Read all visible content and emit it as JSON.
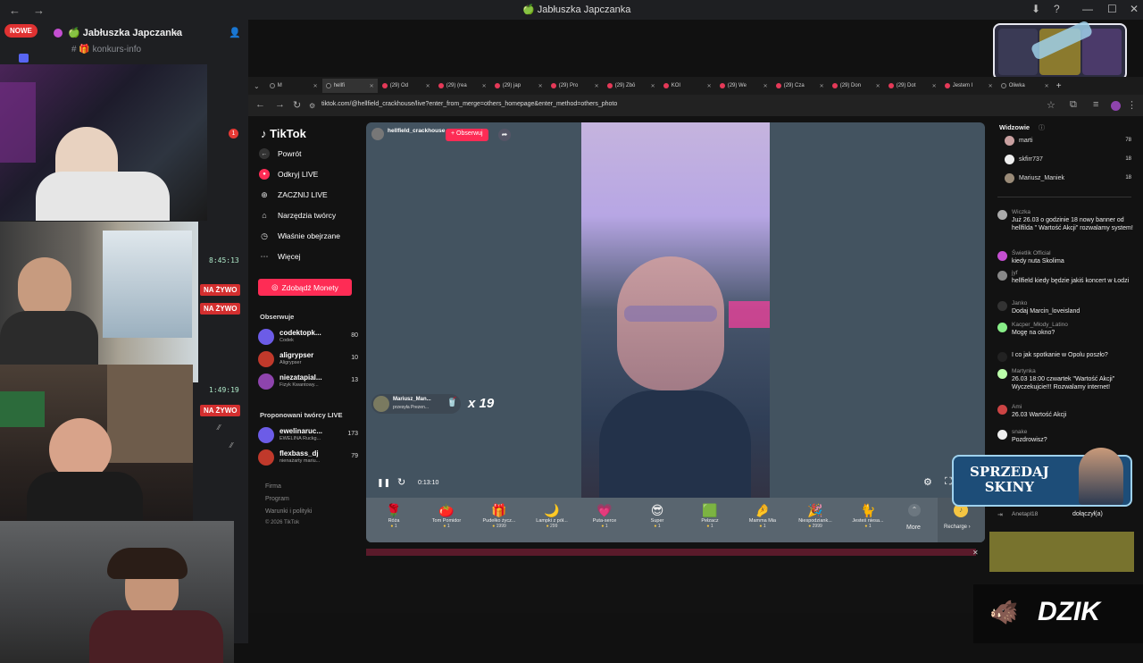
{
  "window": {
    "title": "🍏 Jabłuszka Japczanka",
    "back": "←",
    "forward": "→",
    "controls": [
      "—",
      "☐",
      "✕"
    ]
  },
  "discord": {
    "badge_new": "NOWE",
    "server_name": "🍏 Jabłuszka Japczanka",
    "channel": "# 🎁 konkurs-info",
    "notification_count": "1",
    "streams": [
      {
        "time": "8:45:13",
        "live": "NA ŻYWO"
      },
      {
        "time": "",
        "live": "NA ŻYWO"
      },
      {
        "time": "1:49:19",
        "live": "NA ŻYWO"
      }
    ]
  },
  "browser": {
    "tabs": [
      "M",
      "hellfi",
      "(29) Od",
      "(29) (rea",
      "(29) jap",
      "(29) Pro",
      "(29) Zbō",
      "KOI",
      "(29) We",
      "(29) Cza",
      "(29) Don",
      "(29) Dot",
      "Jestem I",
      "Oliwka"
    ],
    "url": "tiktok.com/@hellfield_crackhouse/live?enter_from_merge=others_homepage&enter_method=others_photo"
  },
  "tiktok": {
    "logo": "TikTok",
    "back_label": "Powrót",
    "menu": [
      {
        "icon": "live-icon",
        "label": "Odkryj LIVE"
      },
      {
        "icon": "go-live-icon",
        "label": "ZACZNIJ LIVE"
      },
      {
        "icon": "tools-icon",
        "label": "Narzędzia twórcy"
      },
      {
        "icon": "history-icon",
        "label": "Właśnie obejrzane"
      },
      {
        "icon": "more-icon",
        "label": "Więcej"
      }
    ],
    "coins_button": "Zdobądź Monety",
    "following_title": "Obserwuje",
    "following": [
      {
        "name": "codektopk...",
        "sub": "Codek",
        "count": "80"
      },
      {
        "name": "aligrypser",
        "sub": "Aligrypser",
        "count": "10"
      },
      {
        "name": "niezatapial...",
        "sub": "Fizyk Kwantowy...",
        "count": "13"
      }
    ],
    "suggested_title": "Proponowani twórcy LIVE",
    "suggested": [
      {
        "name": "ewelinaruc...",
        "sub": "EWELINA Ruckg...",
        "count": "173"
      },
      {
        "name": "flexbass_dj",
        "sub": "nienażarty mariu...",
        "count": "79"
      }
    ],
    "footer": [
      "Firma",
      "Program",
      "Warunki i polityki",
      "© 2026 TikTok"
    ],
    "host": {
      "name": "hellfield_crackhouse",
      "follow": "+ Obserwuj"
    },
    "gift_notice": {
      "user": "Mariusz_Man...",
      "action": "przesyła Prezen...",
      "multiplier": "x 19"
    },
    "player": {
      "time": "0:13:10"
    },
    "gifts": [
      {
        "name": "Róża",
        "price": "1",
        "icon": "🌹"
      },
      {
        "name": "Tom Pomidor",
        "price": "1",
        "icon": "🍅"
      },
      {
        "name": "Pudełko życz...",
        "price": "1999",
        "icon": "🎁"
      },
      {
        "name": "Lampki z pół...",
        "price": "299",
        "icon": "🌙"
      },
      {
        "name": "Puta-serce",
        "price": "1",
        "icon": "💗"
      },
      {
        "name": "Super",
        "price": "1",
        "icon": "😎"
      },
      {
        "name": "Pełzacz",
        "price": "1",
        "icon": "🟩"
      },
      {
        "name": "Mamma Mia",
        "price": "1",
        "icon": "🤌"
      },
      {
        "name": "Niespodziank...",
        "price": "2999",
        "icon": "🎉"
      },
      {
        "name": "Jesteś niesa...",
        "price": "1",
        "icon": "🐈"
      }
    ],
    "more_label": "More",
    "recharge_label": "Recharge ›",
    "viewers_title": "Widzowie",
    "viewers": [
      {
        "name": "marti",
        "count": "78"
      },
      {
        "name": "skfirr737",
        "count": "18"
      },
      {
        "name": "Mariusz_Maniek",
        "count": "18"
      }
    ],
    "chat": [
      {
        "user": "Wiczka",
        "text": "Już 26.03 o godzinie 18 nowy banner od hellfilda \" Wartość Akcji\" rozwalamy system!"
      },
      {
        "user": "Świetlik Official",
        "text": "kiedy nuta Skolima"
      },
      {
        "user": "jyf",
        "text": "hellfield kiedy będzie jakiś koncert w Łodzi"
      },
      {
        "user": "Janko",
        "text": "Dodaj Marcin_loveisland"
      },
      {
        "user": "Kacper_Młody_Latino",
        "text": "Mogę na okno?"
      },
      {
        "user": "",
        "text": "I co jak spotkanie w Opolu poszło?"
      },
      {
        "user": "Martynka",
        "text": "26.03 18:00 czwartek \"Wartość Akcji\" Wyczekujcie!!! Rozwalamy internet!"
      },
      {
        "user": "Ami",
        "text": "26.03 Wartość Akcji"
      },
      {
        "user": "snake",
        "text": "Pozdrowisz?"
      }
    ],
    "join_notice": {
      "user": "Anetapl18",
      "action": "dołączył(a)"
    }
  },
  "overlays": {
    "sale_text_1": "SPRZEDAJ",
    "sale_text_2": "SKINY",
    "brand": "DZIK"
  }
}
